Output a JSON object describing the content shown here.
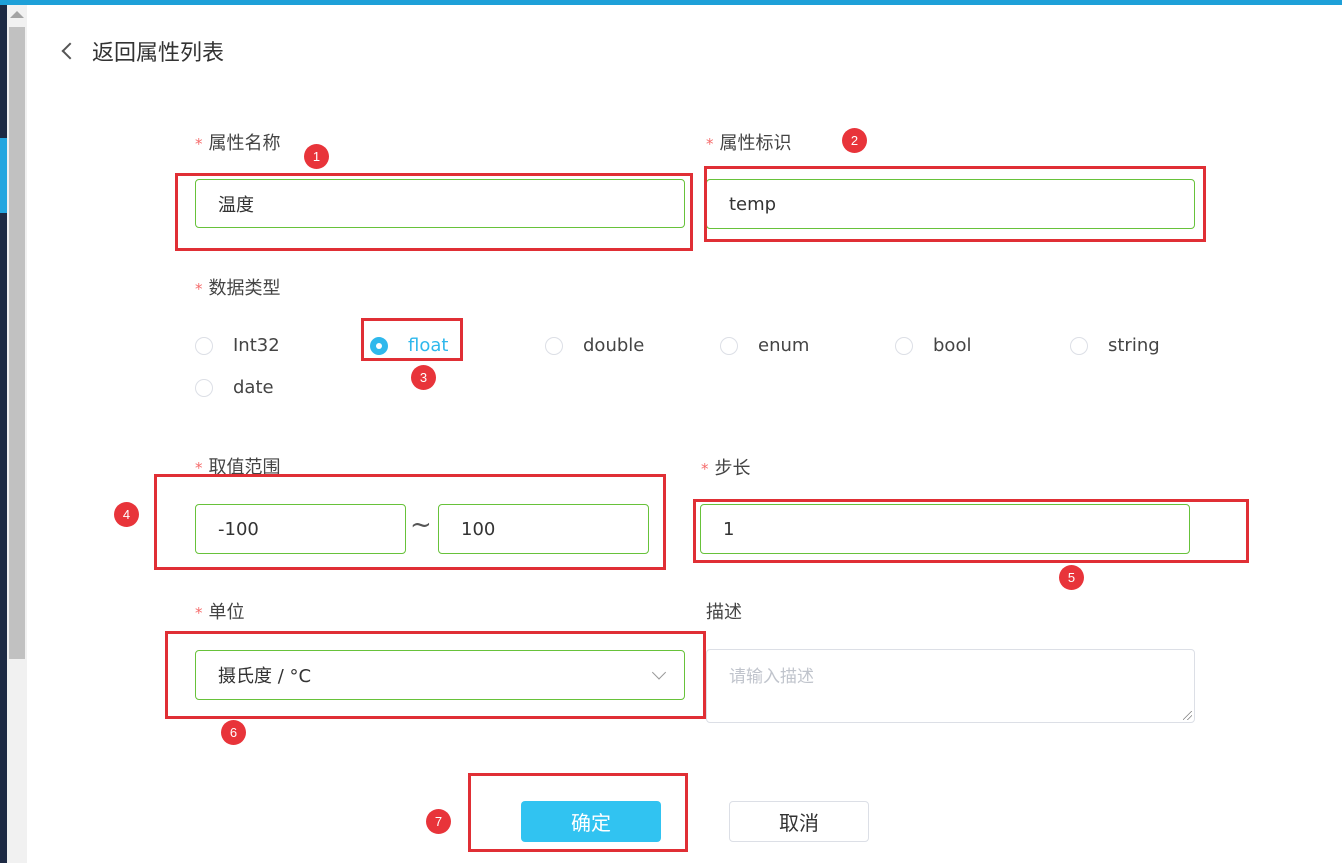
{
  "back_label": "返回属性列表",
  "form": {
    "name": {
      "label": "属性名称",
      "value": "温度"
    },
    "identifier": {
      "label": "属性标识",
      "value": "temp"
    },
    "data_type": {
      "label": "数据类型",
      "options": [
        "Int32",
        "float",
        "double",
        "enum",
        "bool",
        "string",
        "date"
      ],
      "selected": "float"
    },
    "range": {
      "label": "取值范围",
      "min": "-100",
      "separator": "~",
      "max": "100"
    },
    "step": {
      "label": "步长",
      "value": "1"
    },
    "unit": {
      "label": "单位",
      "value": "摄氏度 / °C"
    },
    "description": {
      "label": "描述",
      "placeholder": "请输入描述"
    },
    "required_mark": "*"
  },
  "buttons": {
    "confirm": "确定",
    "cancel": "取消"
  },
  "annotations": [
    "1",
    "2",
    "3",
    "4",
    "5",
    "6",
    "7"
  ],
  "colors": {
    "accent": "#31c3f1",
    "valid_border": "#67c23a",
    "required": "#f56c6c",
    "highlight": "#e02f35"
  }
}
